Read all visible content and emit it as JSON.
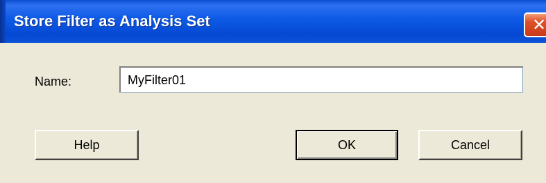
{
  "window": {
    "title": "Store Filter as Analysis Set",
    "close_icon": "close-icon"
  },
  "form": {
    "name_label": "Name:",
    "name_value": "MyFilter01"
  },
  "buttons": {
    "help": "Help",
    "ok": "OK",
    "cancel": "Cancel"
  },
  "colors": {
    "titlebar": "#0d5ae6",
    "close_button": "#e0512a",
    "dialog_bg": "#ece9d8"
  }
}
